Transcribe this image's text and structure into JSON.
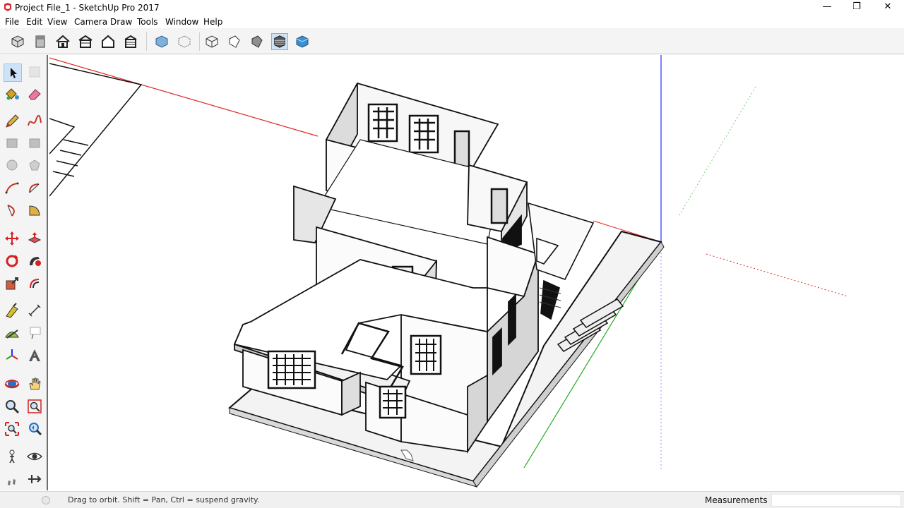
{
  "window": {
    "title": "Project File_1 - SketchUp Pro 2017",
    "controls": [
      "—",
      "❐",
      "✕"
    ]
  },
  "menu": [
    "File",
    "Edit",
    "View",
    "Camera",
    "Draw",
    "Tools",
    "Window",
    "Help"
  ],
  "toolbar": {
    "views": [
      "iso-view-icon",
      "top-view-icon",
      "front-view-icon",
      "right-view-icon",
      "back-view-icon",
      "left-view-icon"
    ],
    "styles": [
      "xray-style-icon",
      "backedges-style-icon",
      "wireframe-style-icon",
      "hiddenline-style-icon",
      "shaded-style-icon",
      "shaded-textures-style-icon",
      "monochrome-style-icon"
    ],
    "active": "shaded-textures-style-icon"
  },
  "tools": {
    "rows": [
      [
        "select",
        "component"
      ],
      [
        "paint-bucket",
        "eraser"
      ],
      [
        "pencil",
        "freehand"
      ],
      [
        "rectangle",
        "rotated-rectangle"
      ],
      [
        "circle",
        "polygon"
      ],
      [
        "arc",
        "two-point-arc"
      ],
      [
        "three-point-arc",
        "pie"
      ],
      [
        "move",
        "push-pull"
      ],
      [
        "rotate",
        "follow-me"
      ],
      [
        "scale",
        "offset"
      ],
      [
        "tape-measure",
        "dimension"
      ],
      [
        "protractor",
        "text"
      ],
      [
        "axes",
        "3d-text"
      ],
      [
        "orbit",
        "pan"
      ],
      [
        "zoom",
        "zoom-window"
      ],
      [
        "zoom-extents",
        "previous-view"
      ],
      [
        "position-camera",
        "look-around"
      ],
      [
        "walk",
        "section-plane"
      ]
    ],
    "active": "select"
  },
  "colors": {
    "red_axis": "#e02424",
    "green_axis": "#22aa22",
    "blue_axis": "#2a2aff",
    "wall": "#f6f6f6",
    "edge": "#111111",
    "accent": "#2f7ed8"
  },
  "status": {
    "text": "Drag to orbit. Shift = Pan, Ctrl = suspend gravity.",
    "measurements_label": "Measurements",
    "measurements_value": ""
  }
}
